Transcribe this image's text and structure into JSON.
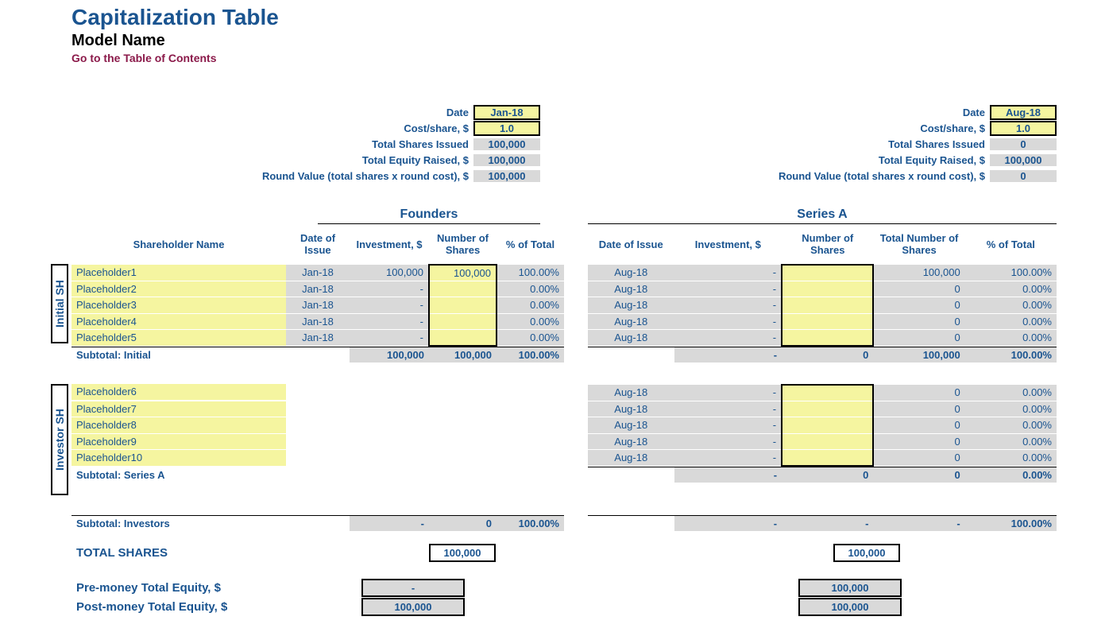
{
  "header": {
    "title": "Capitalization Table",
    "subtitle": "Model Name",
    "toc_link": "Go to the Table of Contents"
  },
  "founders": {
    "round_title": "Founders",
    "summary": {
      "date_label": "Date",
      "date_value": "Jan-18",
      "cost_label": "Cost/share, $",
      "cost_value": "1.0",
      "shares_label": "Total Shares Issued",
      "shares_value": "100,000",
      "equity_label": "Total Equity Raised, $",
      "equity_value": "100,000",
      "roundval_label": "Round Value (total shares x round cost), $",
      "roundval_value": "100,000"
    },
    "columns": {
      "shareholder": "Shareholder Name",
      "date": "Date of Issue",
      "investment": "Investment, $",
      "numshares": "Number of Shares",
      "pct": "% of Total"
    }
  },
  "seriesA": {
    "round_title": "Series A",
    "summary": {
      "date_label": "Date",
      "date_value": "Aug-18",
      "cost_label": "Cost/share, $",
      "cost_value": "1.0",
      "shares_label": "Total Shares Issued",
      "shares_value": "0",
      "equity_label": "Total Equity Raised, $",
      "equity_value": "100,000",
      "roundval_label": "Round Value (total shares x round cost), $",
      "roundval_value": "0"
    },
    "columns": {
      "date": "Date of Issue",
      "investment": "Investment, $",
      "numshares": "Number of Shares",
      "totalshares": "Total Number of Shares",
      "pct": "% of Total"
    }
  },
  "labels": {
    "initial_sh": "Initial SH",
    "investor_sh": "Investor SH",
    "subtotal_initial": "Subtotal: Initial",
    "subtotal_seriesA": "Subtotal: Series A",
    "subtotal_investors": "Subtotal: Investors",
    "total_shares": "TOTAL SHARES",
    "pre_money": "Pre-money Total Equity, $",
    "post_money": "Post-money Total Equity, $"
  },
  "initial_rows": [
    {
      "name": "Placeholder1",
      "f_date": "Jan-18",
      "f_inv": "100,000",
      "f_num": "100,000",
      "f_pct": "100.00%",
      "a_date": "Aug-18",
      "a_inv": "-",
      "a_num": "",
      "a_tot": "100,000",
      "a_pct": "100.00%"
    },
    {
      "name": "Placeholder2",
      "f_date": "Jan-18",
      "f_inv": "-",
      "f_num": "",
      "f_pct": "0.00%",
      "a_date": "Aug-18",
      "a_inv": "-",
      "a_num": "",
      "a_tot": "0",
      "a_pct": "0.00%"
    },
    {
      "name": "Placeholder3",
      "f_date": "Jan-18",
      "f_inv": "-",
      "f_num": "",
      "f_pct": "0.00%",
      "a_date": "Aug-18",
      "a_inv": "-",
      "a_num": "",
      "a_tot": "0",
      "a_pct": "0.00%"
    },
    {
      "name": "Placeholder4",
      "f_date": "Jan-18",
      "f_inv": "-",
      "f_num": "",
      "f_pct": "0.00%",
      "a_date": "Aug-18",
      "a_inv": "-",
      "a_num": "",
      "a_tot": "0",
      "a_pct": "0.00%"
    },
    {
      "name": "Placeholder5",
      "f_date": "Jan-18",
      "f_inv": "-",
      "f_num": "",
      "f_pct": "0.00%",
      "a_date": "Aug-18",
      "a_inv": "-",
      "a_num": "",
      "a_tot": "0",
      "a_pct": "0.00%"
    }
  ],
  "subtotal_initial": {
    "f_inv": "100,000",
    "f_num": "100,000",
    "f_pct": "100.00%",
    "a_inv": "-",
    "a_num": "0",
    "a_tot": "100,000",
    "a_pct": "100.00%"
  },
  "investor_rows": [
    {
      "name": "Placeholder6",
      "a_date": "Aug-18",
      "a_inv": "-",
      "a_num": "",
      "a_tot": "0",
      "a_pct": "0.00%"
    },
    {
      "name": "Placeholder7",
      "a_date": "Aug-18",
      "a_inv": "-",
      "a_num": "",
      "a_tot": "0",
      "a_pct": "0.00%"
    },
    {
      "name": "Placeholder8",
      "a_date": "Aug-18",
      "a_inv": "-",
      "a_num": "",
      "a_tot": "0",
      "a_pct": "0.00%"
    },
    {
      "name": "Placeholder9",
      "a_date": "Aug-18",
      "a_inv": "-",
      "a_num": "",
      "a_tot": "0",
      "a_pct": "0.00%"
    },
    {
      "name": "Placeholder10",
      "a_date": "Aug-18",
      "a_inv": "-",
      "a_num": "",
      "a_tot": "0",
      "a_pct": "0.00%"
    }
  ],
  "subtotal_seriesA": {
    "a_inv": "-",
    "a_num": "0",
    "a_tot": "0",
    "a_pct": "0.00%"
  },
  "subtotal_investors": {
    "f_inv": "-",
    "f_num": "0",
    "f_pct": "100.00%",
    "a_inv": "-",
    "a_num": "-",
    "a_tot": "-",
    "a_pct": "100.00%"
  },
  "totals": {
    "founders_total_shares": "100,000",
    "seriesA_total_shares": "100,000",
    "founders_pre": "-",
    "founders_post": "100,000",
    "seriesA_pre": "100,000",
    "seriesA_post": "100,000"
  }
}
